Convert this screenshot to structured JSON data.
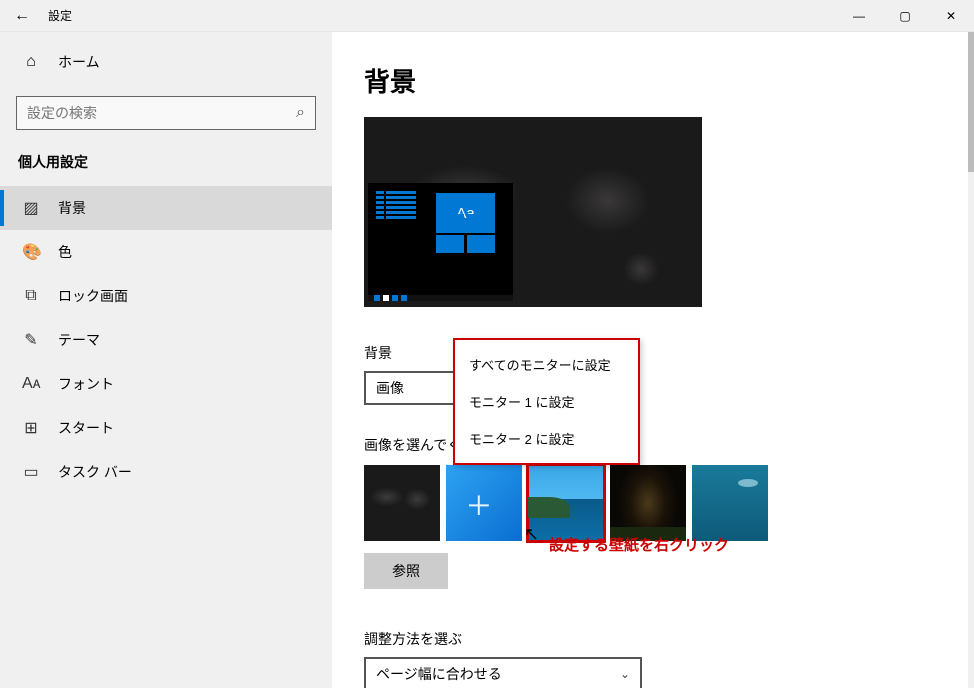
{
  "titlebar": {
    "back_icon": "←",
    "title": "設定"
  },
  "sidebar": {
    "home_label": "ホーム",
    "search_placeholder": "設定の検索",
    "category_title": "個人用設定",
    "items": [
      {
        "icon": "▨",
        "label": "背景",
        "active": true
      },
      {
        "icon": "🎨",
        "label": "色"
      },
      {
        "icon": "⧉",
        "label": "ロック画面"
      },
      {
        "icon": "✎",
        "label": "テーマ"
      },
      {
        "icon": "Aᴀ",
        "label": "フォント"
      },
      {
        "icon": "⊞",
        "label": "スタート"
      },
      {
        "icon": "▭",
        "label": "タスク バー"
      }
    ]
  },
  "content": {
    "page_title": "背景",
    "preview_sample_text": "Aa",
    "bg_type_label": "背景",
    "bg_type_value": "画像",
    "choose_image_label": "画像を選んでください",
    "browse_label": "参照",
    "fit_label": "調整方法を選ぶ",
    "fit_value": "ページ幅に合わせる"
  },
  "context_menu": {
    "items": [
      "すべてのモニターに設定",
      "モニター 1 に設定",
      "モニター 2 に設定"
    ]
  },
  "annotation": {
    "text": "設定する壁紙を右クリック"
  }
}
